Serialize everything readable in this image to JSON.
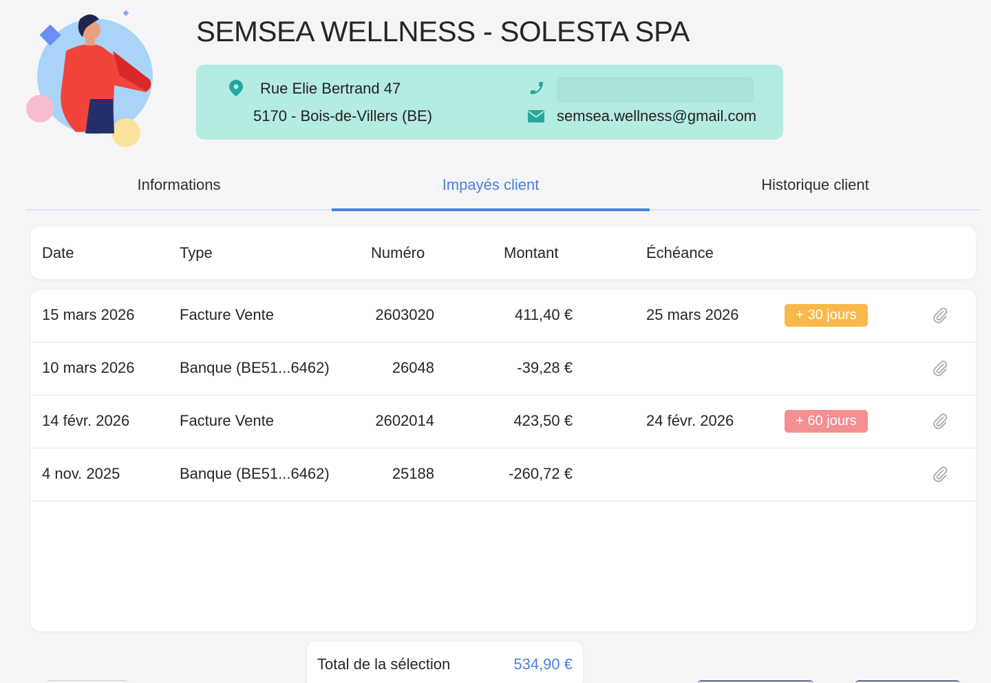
{
  "header": {
    "title": "SEMSEA WELLNESS - SOLESTA SPA",
    "address_line1": "Rue Elie Bertrand 47",
    "address_line2": "5170 - Bois-de-Villers (BE)",
    "email": "semsea.wellness@gmail.com",
    "accent_color": "#b4ebe2"
  },
  "tabs": [
    {
      "label": "Informations",
      "active": false
    },
    {
      "label": "Impayés client",
      "active": true
    },
    {
      "label": "Historique client",
      "active": false
    }
  ],
  "table": {
    "columns": [
      "Date",
      "Type",
      "Numéro",
      "Montant",
      "Échéance"
    ],
    "rows": [
      {
        "date": "15 mars 2026",
        "type": "Facture Vente",
        "number": "2603020",
        "amount": "411,40 €",
        "due": "25 mars 2026",
        "badge": "+ 30 jours",
        "badge_color": "#f8b94a"
      },
      {
        "date": "10 mars 2026",
        "type": "Banque (BE51...6462)",
        "number": "26048",
        "amount": "-39,28 €",
        "due": "",
        "badge": ""
      },
      {
        "date": "14 févr. 2026",
        "type": "Facture Vente",
        "number": "2602014",
        "amount": "423,50 €",
        "due": "24 févr. 2026",
        "badge": "+ 60 jours",
        "badge_color": "#f48f92"
      },
      {
        "date": "4 nov. 2025",
        "type": "Banque (BE51...6462)",
        "number": "25188",
        "amount": "-260,72 €",
        "due": "",
        "badge": ""
      }
    ]
  },
  "total": {
    "label": "Total de la sélection",
    "value": "534,90 €"
  },
  "icons": {
    "address": "map-pin-icon",
    "phone": "phone-icon",
    "email": "envelope-icon",
    "attachment": "paperclip-icon"
  }
}
